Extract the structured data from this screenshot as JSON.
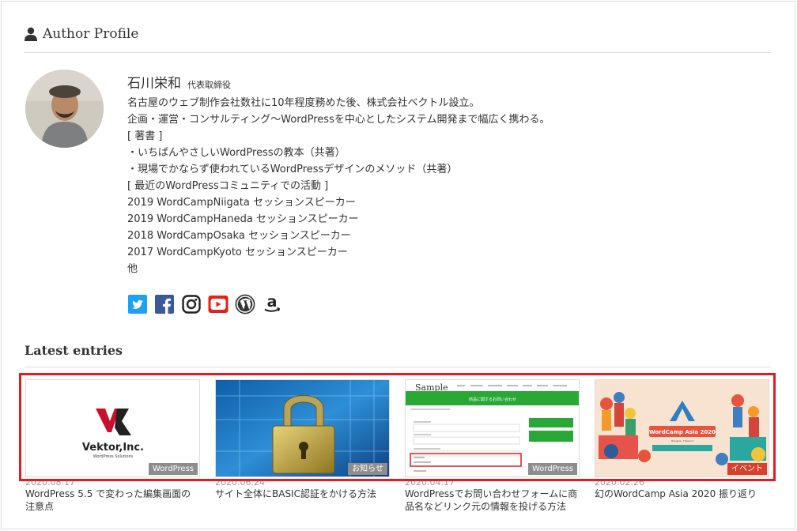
{
  "profile": {
    "heading": "Author Profile",
    "name": "石川栄和",
    "role": "代表取締役",
    "bio": [
      "名古屋のウェブ制作会社数社に10年程度務めた後、株式会社ベクトル設立。",
      "企画・運営・コンサルティング〜WordPressを中心としたシステム開発まで幅広く携わる。",
      "[ 著書 ]",
      "・いちばんやさしいWordPressの教本（共著）",
      "・現場でかならず使われているWordPressデザインのメソッド（共著）",
      "[ 最近のWordPressコミュニティでの活動 ]",
      "2019 WordCampNiigata セッションスピーカー",
      "2019 WordCampHaneda セッションスピーカー",
      "2018 WordCampOsaka セッションスピーカー",
      "2017 WordCampKyoto セッションスピーカー",
      "他"
    ],
    "social_icons": [
      "twitter-icon",
      "facebook-icon",
      "instagram-icon",
      "youtube-icon",
      "wordpress-icon",
      "amazon-icon"
    ]
  },
  "latest": {
    "heading": "Latest entries",
    "entries": [
      {
        "date": "2020.08.17",
        "title": "WordPress 5.5 で変わった編集画面の注意点",
        "category": "WordPress",
        "logo_text": "Vektor,Inc.",
        "logo_sub": "WordPress Solutions"
      },
      {
        "date": "2020.06.24",
        "title": "サイト全体にBASIC認証をかける方法",
        "category": "お知らせ"
      },
      {
        "date": "2020.04.17",
        "title": "WordPressでお問い合わせフォームに商品名などリンク元の情報を投げる方法",
        "category": "WordPress",
        "thumb_brand": "Sample",
        "thumb_banner": "商品に関するお問い合わせ"
      },
      {
        "date": "2020.02.26",
        "title": "幻のWordCamp Asia 2020 振り返り",
        "category": "イベント",
        "thumb_banner": "WordCamp Asia 2020",
        "thumb_place": "Bangkok, Thailand"
      }
    ]
  },
  "colors": {
    "twitter": "#1da1f2",
    "facebook": "#3b5998",
    "youtube": "#e62117",
    "highlight": "#e31b23",
    "category_default": "#8d8d8d",
    "category_event": "#d9412e"
  }
}
